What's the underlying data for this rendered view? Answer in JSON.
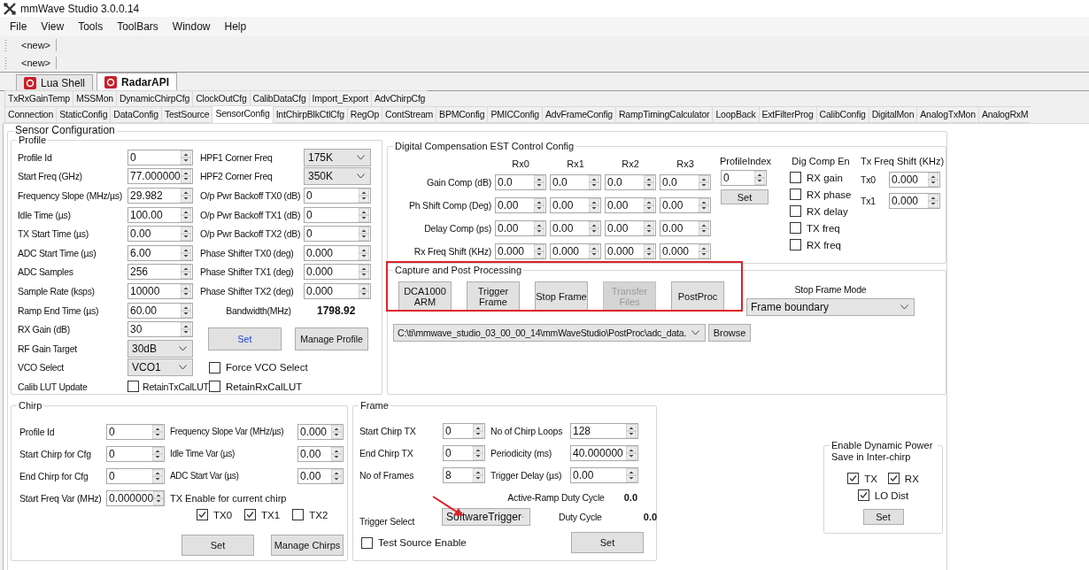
{
  "window": {
    "title": "mmWave Studio 3.0.0.14"
  },
  "menu": [
    "File",
    "View",
    "Tools",
    "ToolBars",
    "Window",
    "Help"
  ],
  "toolbars": [
    {
      "button": "<new>"
    },
    {
      "button": "<new>"
    }
  ],
  "doc_tabs": [
    {
      "label": "Lua Shell",
      "selected": false
    },
    {
      "label": "RadarAPI",
      "selected": true
    }
  ],
  "tab_rows": [
    [
      {
        "label": "TxRxGainTemp",
        "selected": false
      },
      {
        "label": "MSSMon",
        "selected": false
      },
      {
        "label": "DynamicChirpCfg",
        "selected": false
      },
      {
        "label": "ClockOutCfg",
        "selected": false
      },
      {
        "label": "CalibDataCfg",
        "selected": false
      },
      {
        "label": "Import_Export",
        "selected": false
      },
      {
        "label": "AdvChirpCfg",
        "selected": false
      }
    ],
    [
      {
        "label": "Connection",
        "selected": false
      },
      {
        "label": "StaticConfig",
        "selected": false
      },
      {
        "label": "DataConfig",
        "selected": false
      },
      {
        "label": "TestSource",
        "selected": false
      },
      {
        "label": "SensorConfig",
        "selected": true
      },
      {
        "label": "IntChirpBlkCtlCfg",
        "selected": false
      },
      {
        "label": "RegOp",
        "selected": false
      },
      {
        "label": "ContStream",
        "selected": false
      },
      {
        "label": "BPMConfig",
        "selected": false
      },
      {
        "label": "PMICConfig",
        "selected": false
      },
      {
        "label": "AdvFrameConfig",
        "selected": false
      },
      {
        "label": "RampTimingCalculator",
        "selected": false
      },
      {
        "label": "LoopBack",
        "selected": false
      },
      {
        "label": "ExtFilterProg",
        "selected": false
      },
      {
        "label": "CalibConfig",
        "selected": false
      },
      {
        "label": "DigitalMon",
        "selected": false
      },
      {
        "label": "AnalogTxMon",
        "selected": false
      },
      {
        "label": "AnalogRxM",
        "selected": false
      }
    ]
  ],
  "sensor_config": {
    "title": "Sensor Configuration",
    "profile": {
      "title": "Profile",
      "left": [
        {
          "kind": "spinner",
          "label": "Profile Id",
          "value": "0"
        },
        {
          "kind": "spinner",
          "label": "Start Freq (GHz)",
          "value": "77.000000"
        },
        {
          "kind": "spinner",
          "label": "Frequency Slope (MHz/µs)",
          "value": "29.982"
        },
        {
          "kind": "spinner",
          "label": "Idle Time (µs)",
          "value": "100.00"
        },
        {
          "kind": "spinner",
          "label": "TX Start Time (µs)",
          "value": "0.00"
        },
        {
          "kind": "spinner",
          "label": "ADC Start Time (µs)",
          "value": "6.00"
        },
        {
          "kind": "spinner",
          "label": "ADC Samples",
          "value": "256"
        },
        {
          "kind": "spinner",
          "label": "Sample Rate (ksps)",
          "value": "10000"
        },
        {
          "kind": "spinner",
          "label": "Ramp End Time (µs)",
          "value": "60.00"
        },
        {
          "kind": "spinner",
          "label": "RX Gain (dB)",
          "value": "30"
        },
        {
          "kind": "dropdown",
          "label": "RF Gain Target",
          "value": "30dB"
        },
        {
          "kind": "dropdown",
          "label": "VCO Select",
          "value": "VCO1"
        },
        {
          "kind": "check",
          "label": "Calib LUT Update",
          "check_label": "RetainTxCalLUT",
          "checked": false
        }
      ],
      "right": [
        {
          "kind": "dropdown",
          "label": "HPF1 Corner Freq",
          "value": "175K"
        },
        {
          "kind": "dropdown",
          "label": "HPF2 Corner Freq",
          "value": "350K"
        },
        {
          "kind": "spinner",
          "label": "O/p Pwr Backoff TX0 (dB)",
          "value": "0"
        },
        {
          "kind": "spinner",
          "label": "O/p Pwr Backoff TX1 (dB)",
          "value": "0"
        },
        {
          "kind": "spinner",
          "label": "O/p Pwr Backoff TX2 (dB)",
          "value": "0"
        },
        {
          "kind": "spinner",
          "label": "Phase Shifter TX0 (deg)",
          "value": "0.000"
        },
        {
          "kind": "spinner",
          "label": "Phase Shifter TX1 (deg)",
          "value": "0.000"
        },
        {
          "kind": "spinner",
          "label": "Phase Shifter TX2 (deg)",
          "value": "0.000"
        },
        {
          "kind": "readout",
          "label": "Bandwidth(MHz)",
          "value": "1798.92"
        },
        {
          "kind": "buttons",
          "buttons": [
            {
              "label": "Set",
              "default": true
            },
            {
              "label": "Manage Profile",
              "default": false
            }
          ]
        },
        {
          "kind": "checkbox",
          "label": "Force VCO Select",
          "checked": false
        },
        {
          "kind": "checkbox",
          "label": "RetainRxCalLUT",
          "checked": false
        }
      ]
    },
    "digital_comp": {
      "title": "Digital Compensation EST Control Config",
      "columns": [
        "Rx0",
        "Rx1",
        "Rx2",
        "Rx3"
      ],
      "rows": [
        {
          "label": "Gain Comp (dB)",
          "values": [
            "0.0",
            "0.0",
            "0.0",
            "0.0"
          ]
        },
        {
          "label": "Ph Shift Comp (Deg)",
          "values": [
            "0.00",
            "0.00",
            "0.00",
            "0.00"
          ]
        },
        {
          "label": "Delay Comp (ps)",
          "values": [
            "0.00",
            "0.00",
            "0.00",
            "0.00"
          ]
        },
        {
          "label": "Rx Freq Shift (KHz)",
          "values": [
            "0.000",
            "0.000",
            "0.000",
            "0.000"
          ]
        }
      ],
      "profile_index": {
        "label": "ProfileIndex",
        "value": "0",
        "button": "Set"
      },
      "dig_comp_en": {
        "label": "Dig Comp En",
        "options": [
          {
            "label": "RX gain",
            "checked": false
          },
          {
            "label": "RX phase",
            "checked": false
          },
          {
            "label": "RX delay",
            "checked": false
          },
          {
            "label": "TX freq",
            "checked": false
          },
          {
            "label": "RX freq",
            "checked": false
          }
        ]
      },
      "tx_freq_shift": {
        "label": "Tx Freq Shift (KHz)",
        "rows": [
          {
            "label": "Tx0",
            "value": "0.000"
          },
          {
            "label": "Tx1",
            "value": "0.000"
          }
        ]
      }
    },
    "capture": {
      "title": "Capture and Post Processing",
      "buttons": [
        {
          "label": "DCA1000 ARM",
          "disabled": false
        },
        {
          "label": "Trigger Frame",
          "disabled": false
        },
        {
          "label": "Stop Frame",
          "disabled": false
        },
        {
          "label": "Transfer Files",
          "disabled": true
        },
        {
          "label": "PostProc",
          "disabled": false
        }
      ],
      "stop_frame_mode": {
        "label": "Stop Frame Mode",
        "value": "Frame boundary"
      },
      "path": "C:\\ti\\mmwave_studio_03_00_00_14\\mmWaveStudio\\PostProc\\adc_data.",
      "browse": "Browse"
    },
    "chirp": {
      "title": "Chirp",
      "left": [
        {
          "kind": "spinner",
          "label": "Profile Id",
          "value": "0"
        },
        {
          "kind": "spinner",
          "label": "Start Chirp for Cfg",
          "value": "0"
        },
        {
          "kind": "spinner",
          "label": "End Chirp for Cfg",
          "value": "0"
        },
        {
          "kind": "spinner",
          "label": "Start Freq Var (MHz)",
          "value": "0.000000"
        }
      ],
      "right": [
        {
          "kind": "spinner",
          "label": "Frequency Slope Var (MHz/µs)",
          "value": "0.000"
        },
        {
          "kind": "spinner",
          "label": "Idle Time Var (µs)",
          "value": "0.00"
        },
        {
          "kind": "spinner",
          "label": "ADC Start Var (µs)",
          "value": "0.00"
        },
        {
          "kind": "heading",
          "label": "TX Enable for current chirp"
        }
      ],
      "tx_enable": [
        {
          "label": "TX0",
          "checked": true
        },
        {
          "label": "TX1",
          "checked": true
        },
        {
          "label": "TX2",
          "checked": false
        }
      ],
      "buttons": [
        {
          "label": "Set"
        },
        {
          "label": "Manage Chirps"
        }
      ]
    },
    "frame": {
      "title": "Frame",
      "left": [
        {
          "kind": "spinner",
          "label": "Start Chirp TX",
          "value": "0"
        },
        {
          "kind": "spinner",
          "label": "End Chirp TX",
          "value": "0"
        },
        {
          "kind": "spinner",
          "label": "No of Frames",
          "value": "8"
        }
      ],
      "right": [
        {
          "kind": "spinner",
          "label": "No of Chirp Loops",
          "value": "128"
        },
        {
          "kind": "spinner",
          "label": "Periodicity (ms)",
          "value": "40.000000"
        },
        {
          "kind": "spinner",
          "label": "Trigger Delay (µs)",
          "value": "0.00"
        }
      ],
      "active_ramp_duty_cycle": {
        "label": "Active-Ramp Duty Cycle",
        "value": "0.0"
      },
      "trigger_select": {
        "label": "Trigger Select",
        "value": "SoftwareTrigger"
      },
      "duty_cycle": {
        "label": "Duty Cycle",
        "value": "0.0"
      },
      "test_source_enable": {
        "label": "Test Source Enable",
        "checked": false
      },
      "button": "Set"
    },
    "dynamic_power": {
      "title": "Enable Dynamic Power Save in Inter-chirp",
      "options": [
        {
          "label": "TX",
          "checked": true
        },
        {
          "label": "RX",
          "checked": true
        },
        {
          "label": "LO Dist",
          "checked": true
        }
      ],
      "button": "Set"
    }
  }
}
